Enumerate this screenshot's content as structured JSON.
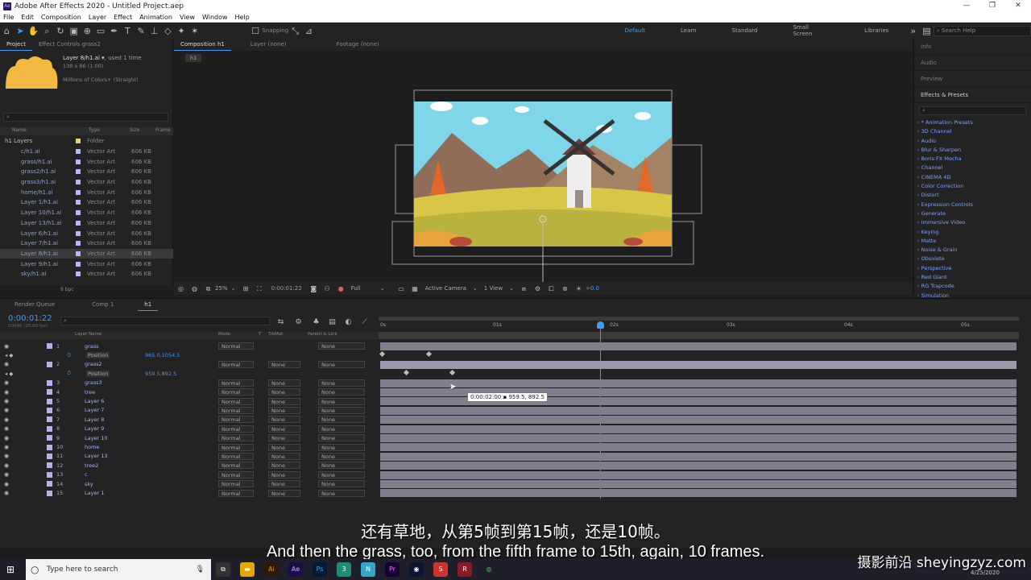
{
  "app": {
    "title": "Adobe After Effects 2020 - Untitled Project.aep"
  },
  "menu": [
    "File",
    "Edit",
    "Composition",
    "Layer",
    "Effect",
    "Animation",
    "View",
    "Window",
    "Help"
  ],
  "toolbar": {
    "snapping": "Snapping",
    "workspaces": [
      "Default",
      "Learn",
      "Standard",
      "Small Screen",
      "Libraries"
    ],
    "search_placeholder": "Search Help"
  },
  "project": {
    "tabs": [
      "Project",
      "Effect Controls grass2"
    ],
    "selected_name": "Layer 8/h1.ai",
    "selected_info1": ", used 1 time",
    "selected_info2": "138 x 86 (1.00)",
    "selected_info3": "Millions of Colors+ (Straight)",
    "columns": [
      "Name",
      "Type",
      "Size",
      "Frame"
    ],
    "folder": {
      "name": "h1 Layers",
      "type": "Folder"
    },
    "items": [
      {
        "name": "c/h1.ai",
        "type": "Vector Art",
        "size": "606 KB"
      },
      {
        "name": "grass/h1.ai",
        "type": "Vector Art",
        "size": "606 KB"
      },
      {
        "name": "grass2/h1.ai",
        "type": "Vector Art",
        "size": "606 KB"
      },
      {
        "name": "grass3/h1.ai",
        "type": "Vector Art",
        "size": "606 KB"
      },
      {
        "name": "home/h1.ai",
        "type": "Vector Art",
        "size": "606 KB"
      },
      {
        "name": "Layer 1/h1.ai",
        "type": "Vector Art",
        "size": "606 KB"
      },
      {
        "name": "Layer 10/h1.ai",
        "type": "Vector Art",
        "size": "606 KB"
      },
      {
        "name": "Layer 13/h1.ai",
        "type": "Vector Art",
        "size": "606 KB"
      },
      {
        "name": "Layer 6/h1.ai",
        "type": "Vector Art",
        "size": "606 KB"
      },
      {
        "name": "Layer 7/h1.ai",
        "type": "Vector Art",
        "size": "606 KB"
      },
      {
        "name": "Layer 8/h1.ai",
        "type": "Vector Art",
        "size": "606 KB"
      },
      {
        "name": "Layer 9/h1.ai",
        "type": "Vector Art",
        "size": "606 KB"
      },
      {
        "name": "sky/h1.ai",
        "type": "Vector Art",
        "size": "606 KB"
      }
    ],
    "bpc": "8 bpc"
  },
  "viewer": {
    "tabs": [
      "Composition h1",
      "Layer (none)",
      "Footage (none)"
    ],
    "comp_tab": "h1",
    "zoom": "25%",
    "timecode": "0:00:01:22",
    "resolution": "Full",
    "camera": "Active Camera",
    "views": "1 View",
    "exposure": "+0.0"
  },
  "right_panel": {
    "sections": [
      "Info",
      "Audio",
      "Preview",
      "Effects & Presets"
    ],
    "effects": [
      "* Animation Presets",
      "3D Channel",
      "Audio",
      "Blur & Sharpen",
      "Boris FX Mocha",
      "Channel",
      "CINEMA 4D",
      "Color Correction",
      "Distort",
      "Expression Controls",
      "Generate",
      "Immersive Video",
      "Keying",
      "Matte",
      "Noise & Grain",
      "Obsolete",
      "Perspective",
      "Red Giant",
      "RG Trapcode",
      "Simulation"
    ]
  },
  "timeline": {
    "tabs": [
      "Render Queue",
      "Comp 1",
      "h1"
    ],
    "timecode": "0:00:01:22",
    "fps_info": "00046 (25.00 fps)",
    "columns": [
      "Layer Name",
      "Mode",
      "T",
      "TrkMat",
      "Parent & Link"
    ],
    "ruler": [
      "0s",
      "01s",
      "02s",
      "03s",
      "04s",
      "05s"
    ],
    "tooltip": "0:00:02:00 ▪ 959.5, 892.5",
    "layers": [
      {
        "num": "1",
        "name": "grass",
        "mode": "Normal",
        "trkmat": "",
        "parent": "None",
        "prop": "Position",
        "prop_val": "965.0,1054.5"
      },
      {
        "num": "2",
        "name": "grass2",
        "mode": "Normal",
        "trkmat": "None",
        "parent": "None",
        "prop": "Position",
        "prop_val": "959.5,892.5"
      },
      {
        "num": "3",
        "name": "grass3",
        "mode": "Normal",
        "trkmat": "None",
        "parent": "None"
      },
      {
        "num": "4",
        "name": "tree",
        "mode": "Normal",
        "trkmat": "None",
        "parent": "None"
      },
      {
        "num": "5",
        "name": "Layer 6",
        "mode": "Normal",
        "trkmat": "None",
        "parent": "None"
      },
      {
        "num": "6",
        "name": "Layer 7",
        "mode": "Normal",
        "trkmat": "None",
        "parent": "None"
      },
      {
        "num": "7",
        "name": "Layer 8",
        "mode": "Normal",
        "trkmat": "None",
        "parent": "None"
      },
      {
        "num": "8",
        "name": "Layer 9",
        "mode": "Normal",
        "trkmat": "None",
        "parent": "None"
      },
      {
        "num": "9",
        "name": "Layer 10",
        "mode": "Normal",
        "trkmat": "None",
        "parent": "None"
      },
      {
        "num": "10",
        "name": "home",
        "mode": "Normal",
        "trkmat": "None",
        "parent": "None"
      },
      {
        "num": "11",
        "name": "Layer 13",
        "mode": "Normal",
        "trkmat": "None",
        "parent": "None"
      },
      {
        "num": "12",
        "name": "tree2",
        "mode": "Normal",
        "trkmat": "None",
        "parent": "None"
      },
      {
        "num": "13",
        "name": "c",
        "mode": "Normal",
        "trkmat": "None",
        "parent": "None"
      },
      {
        "num": "14",
        "name": "sky",
        "mode": "Normal",
        "trkmat": "None",
        "parent": "None"
      },
      {
        "num": "15",
        "name": "Layer 1",
        "mode": "Normal",
        "trkmat": "None",
        "parent": "None"
      }
    ]
  },
  "subtitles": {
    "cn": "还有草地，从第5帧到第15帧，还是10帧。",
    "en": "And then the grass, too, from the fifth frame to 15th, again, 10 frames."
  },
  "taskbar": {
    "search_placeholder": "Type here to search",
    "date": "4/25/2020"
  },
  "watermark": "摄影前沿 sheyingzyz.com"
}
